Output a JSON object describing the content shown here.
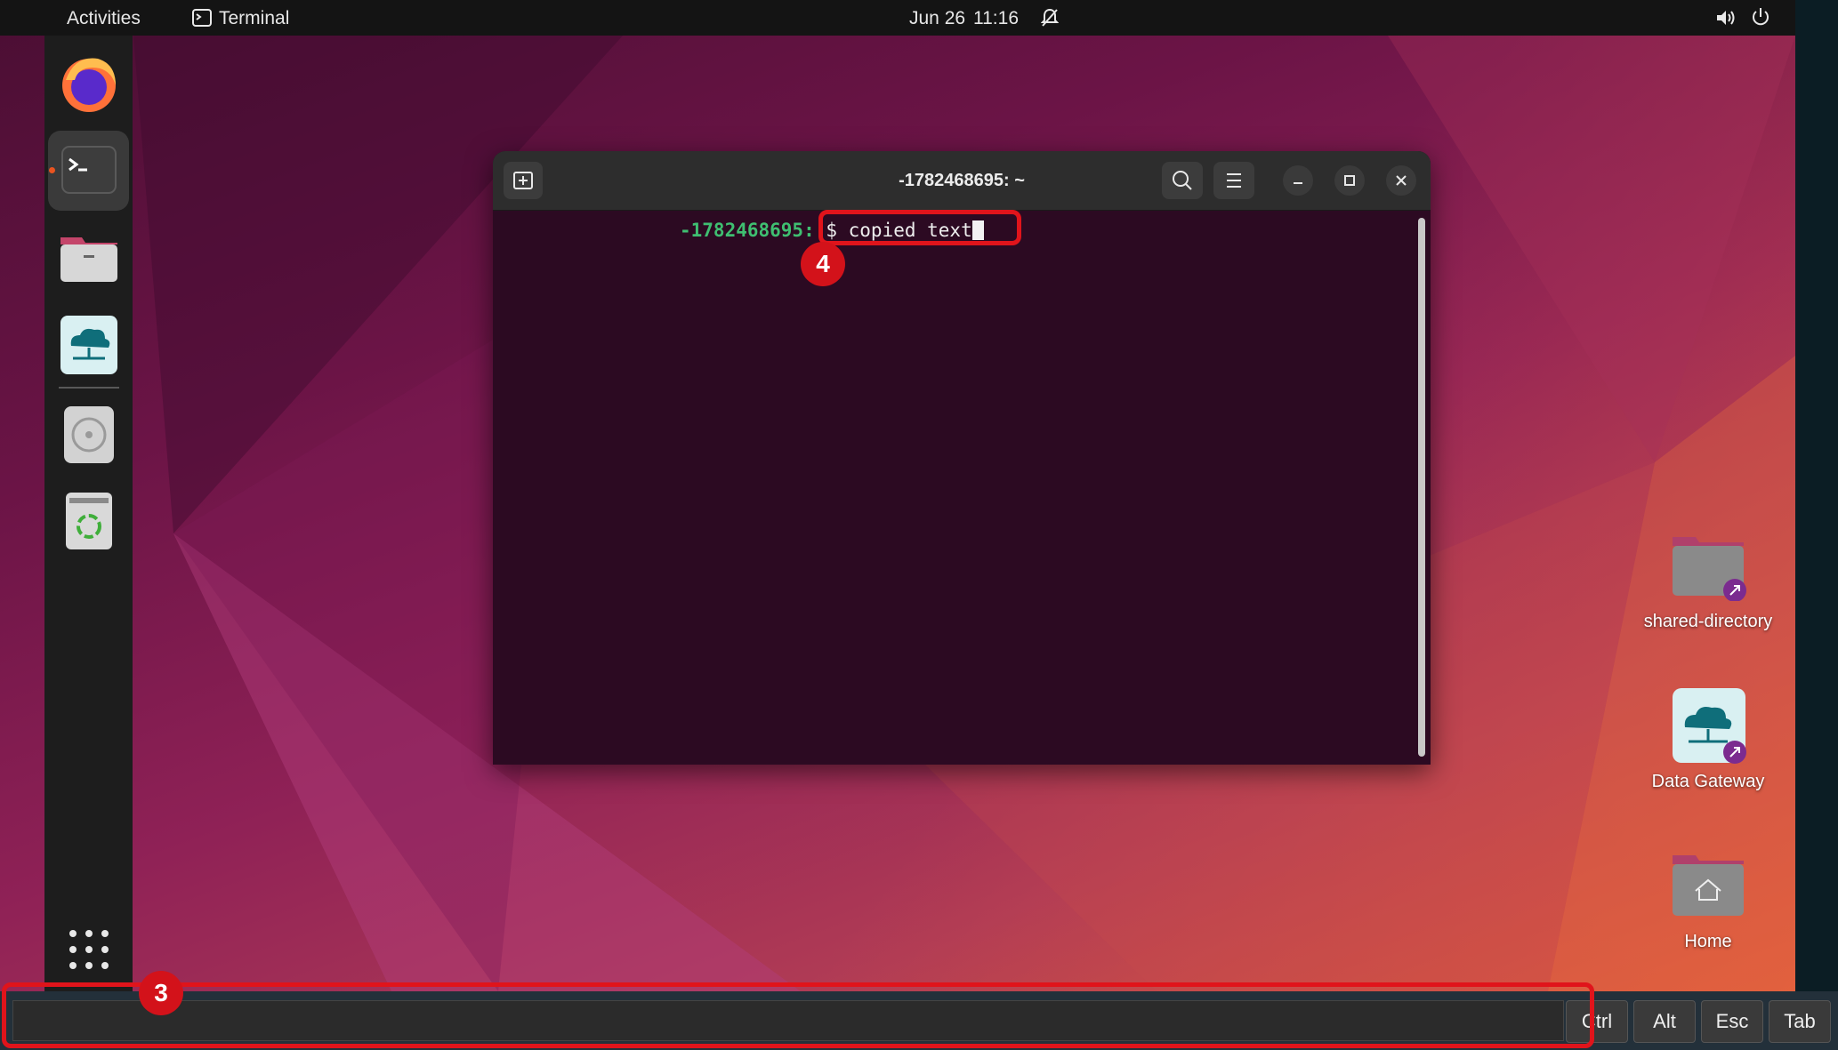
{
  "topbar": {
    "activities": "Activities",
    "app_name": "Terminal",
    "date": "Jun 26",
    "time": "11:16"
  },
  "terminal": {
    "title": "-1782468695: ~",
    "prompt_host": "-1782468695:",
    "prompt_cmd": " $ copied text"
  },
  "desktop_icons": {
    "shared": "shared-directory",
    "gateway": "Data Gateway",
    "home": "Home"
  },
  "bottom_bar": {
    "keys": [
      "Ctrl",
      "Alt",
      "Esc",
      "Tab"
    ]
  },
  "annotations": {
    "badge3": "3",
    "badge4": "4"
  },
  "colors": {
    "highlight": "#e0141b",
    "prompt_green": "#3fbf71",
    "accent_orange": "#e95420"
  }
}
